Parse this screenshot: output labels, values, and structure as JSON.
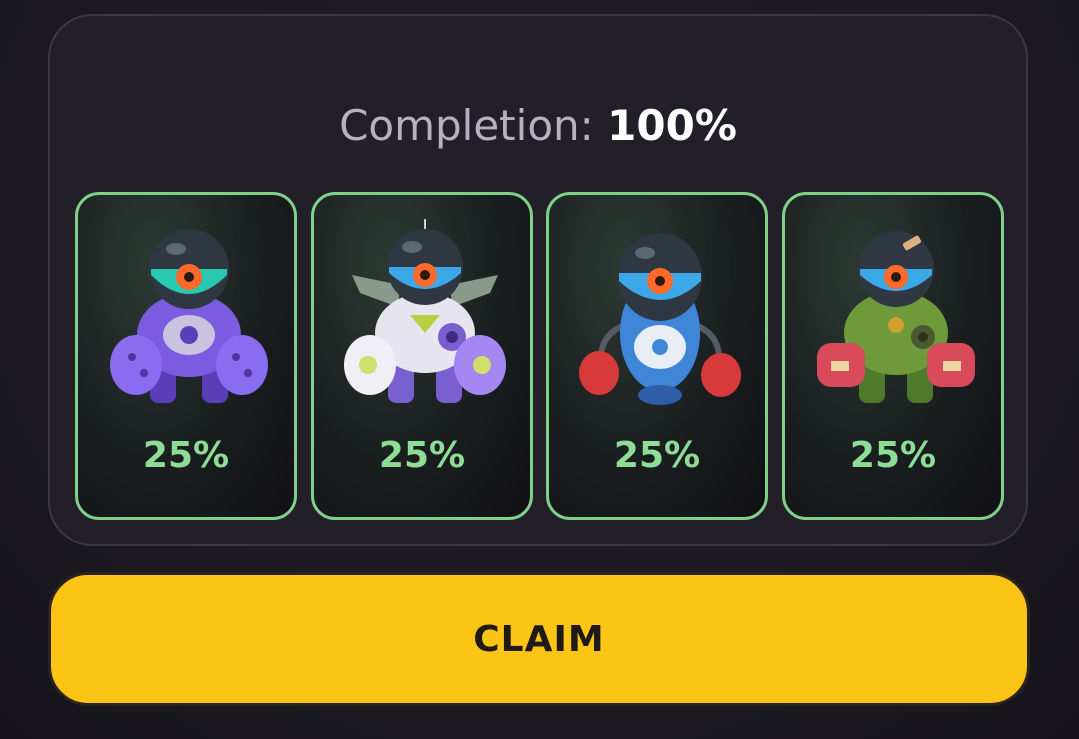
{
  "completion": {
    "label": "Completion:",
    "value": "100%",
    "progress_fraction": 1.0
  },
  "robots": [
    {
      "percent": "25%",
      "icon": "purple-mech-robot-icon",
      "body_color": "#7b5ce0"
    },
    {
      "percent": "25%",
      "icon": "white-purple-winged-robot-icon",
      "body_color": "#9e86e8"
    },
    {
      "percent": "25%",
      "icon": "blue-boxer-robot-icon",
      "body_color": "#4a8fd8"
    },
    {
      "percent": "25%",
      "icon": "green-red-mech-robot-icon",
      "body_color": "#6f9a3a"
    }
  ],
  "claim_button": {
    "label": "CLAIM"
  },
  "colors": {
    "accent_green": "#8fdc96",
    "card_border": "#7fd18a",
    "claim_yellow": "#fcc414",
    "background": "#1d1a22"
  }
}
